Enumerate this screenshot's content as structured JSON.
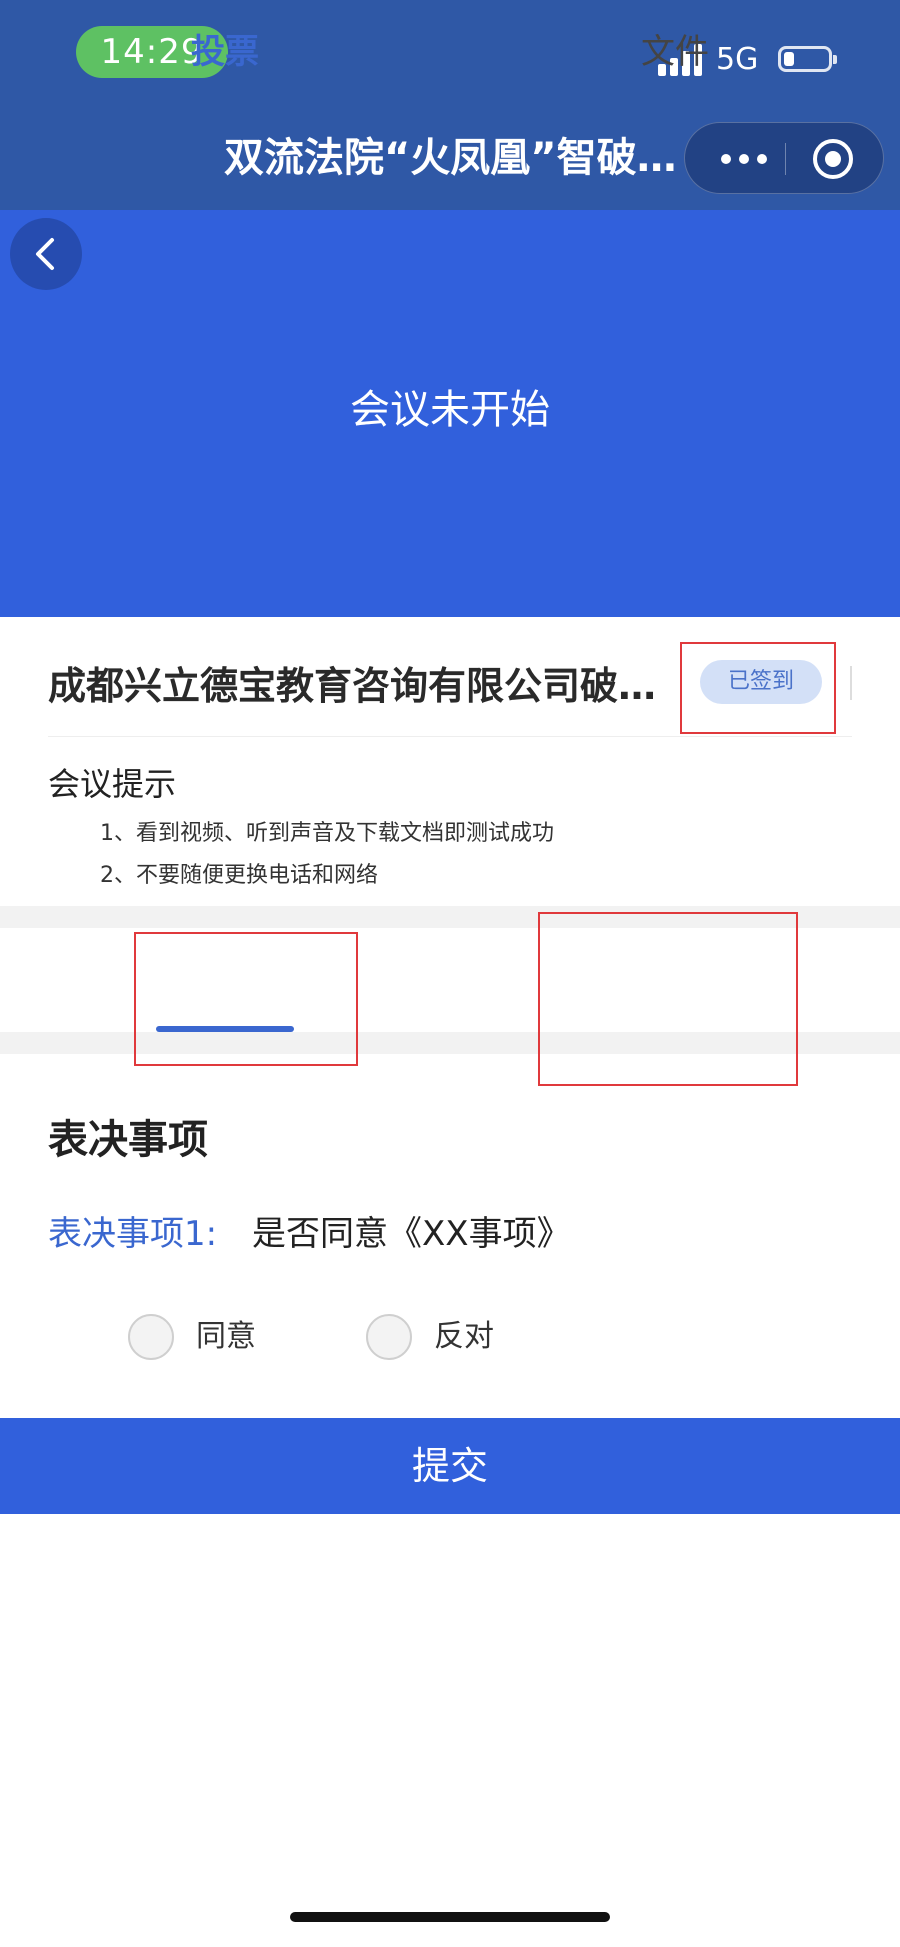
{
  "status_bar": {
    "time": "14:29",
    "network": "5G"
  },
  "title_bar": {
    "title": "双流法院“火凤凰”智破…"
  },
  "video": {
    "status": "会议未开始"
  },
  "meeting": {
    "name": "成都兴立德宝教育咨询有限公司破…",
    "checkin_badge": "已签到",
    "tips_title": "会议提示",
    "tips": [
      "1、看到视频、听到声音及下载文档即测试成功",
      "2、不要随便更换电话和网络"
    ]
  },
  "tabs": [
    {
      "label": "投票",
      "active": true
    },
    {
      "label": "文件",
      "active": false
    }
  ],
  "voting": {
    "section_title": "表决事项",
    "item_label": "表决事项1:",
    "item_text": "是否同意《XX事项》",
    "options": [
      "同意",
      "反对"
    ],
    "submit_label": "提交"
  },
  "colors": {
    "header_blue": "#2f58a6",
    "primary_blue": "#3160dc",
    "accent_blue": "#3a67cf",
    "time_pill_green": "#5ec163",
    "annotation_red": "#e0393c"
  },
  "icons": [
    "signal-icon",
    "battery-icon",
    "more-icon",
    "target-icon",
    "back-arrow-icon"
  ]
}
